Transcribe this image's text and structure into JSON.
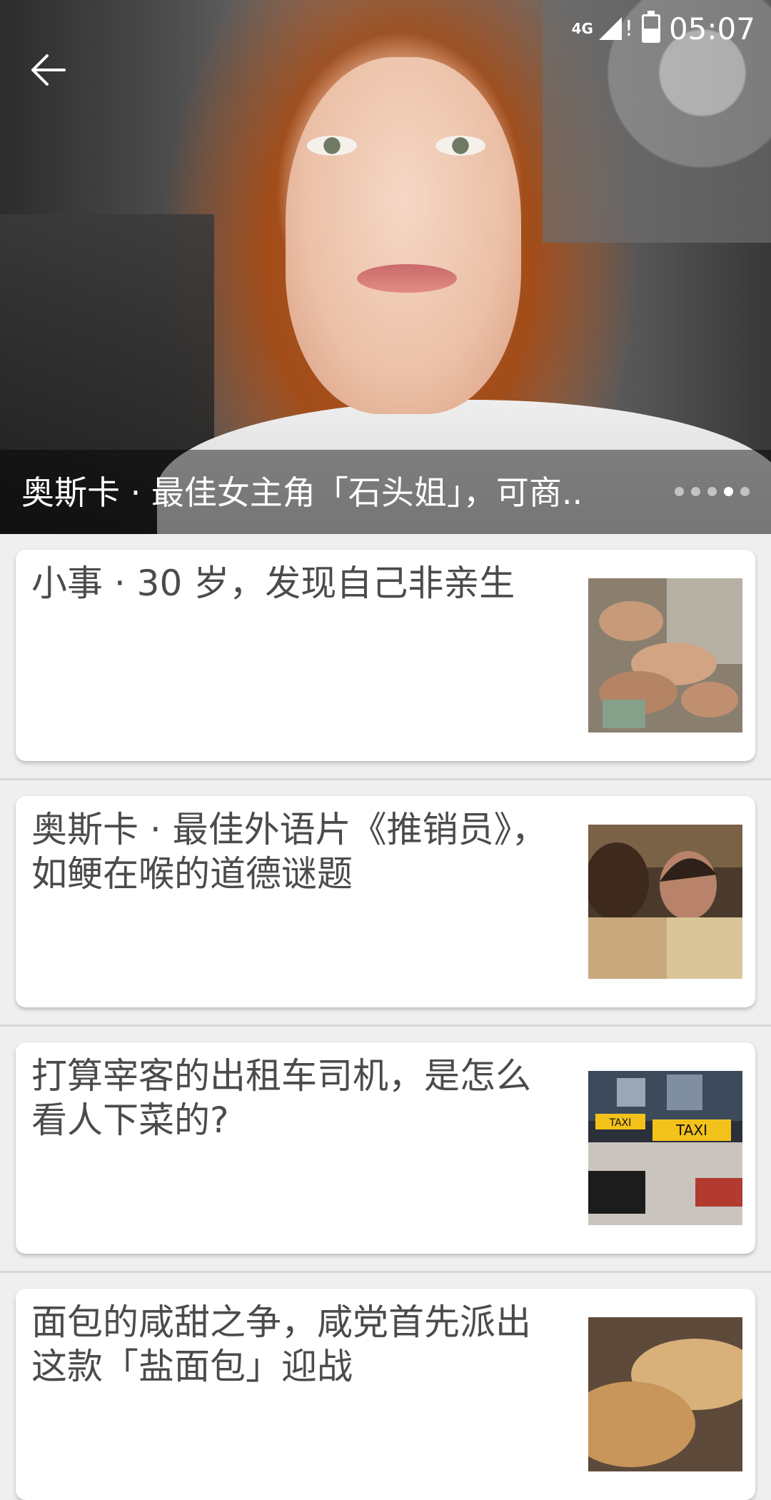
{
  "status_bar": {
    "network": "4G",
    "time": "05:07",
    "battery_level": 0.5
  },
  "hero": {
    "caption": "奥斯卡 · 最佳女主角「石头姐」，可商..",
    "carousel_count": 5,
    "carousel_active_index": 3
  },
  "articles": [
    {
      "title": "小事 · 30 岁，发现自己非亲生",
      "thumb_icon": "family-sleeping-photo"
    },
    {
      "title": "奥斯卡 · 最佳外语片《推销员》，如鲠在喉的道德谜题",
      "thumb_icon": "salesman-film-still"
    },
    {
      "title": "打算宰客的出租车司机，是怎么看人下菜的?",
      "thumb_icon": "taxi-photo"
    },
    {
      "title": "面包的咸甜之争，咸党首先派出这款「盐面包」迎战",
      "thumb_icon": "bread-photo"
    }
  ]
}
